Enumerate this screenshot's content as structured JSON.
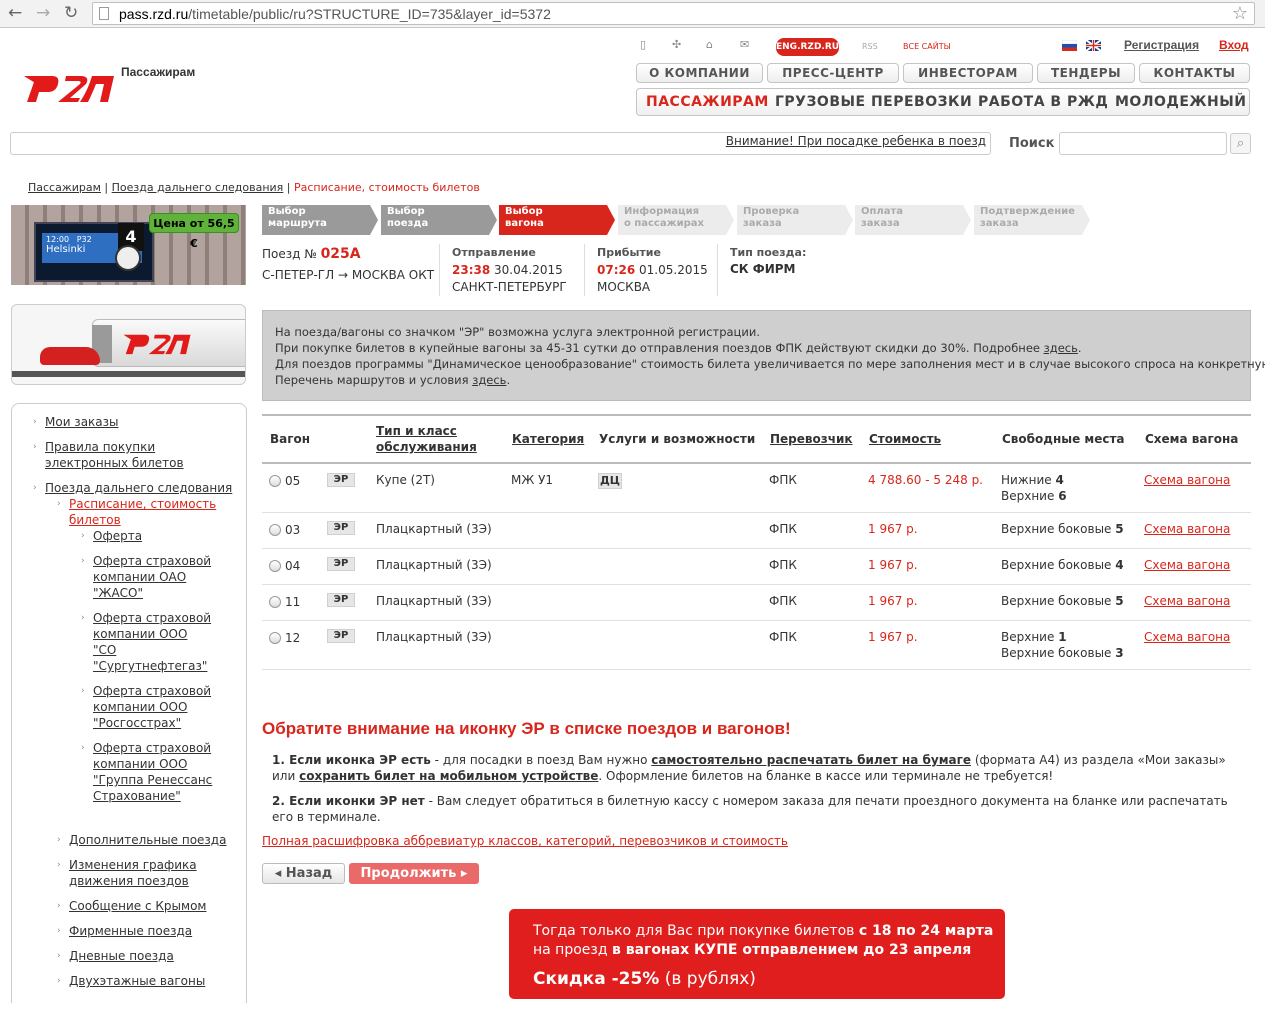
{
  "browser": {
    "url_host": "pass.rzd.ru",
    "url_path": "/timetable/public/ru?STRUCTURE_ID=735&layer_id=5372"
  },
  "header": {
    "logo_text": "Пассажирам",
    "eng": "ENG.RZD.RU",
    "rss": "RSS",
    "all_sites": "ВСЕ САЙТЫ",
    "register": "Регистрация",
    "login": "Вход",
    "top_nav": [
      "О КОМПАНИИ",
      "ПРЕСС-ЦЕНТР",
      "ИНВЕСТОРАМ",
      "ТЕНДЕРЫ",
      "КОНТАКТЫ"
    ],
    "main_nav": [
      "ПАССАЖИРАМ",
      "ГРУЗОВЫЕ ПЕРЕВОЗКИ",
      "РАБОТА В РЖД",
      "МОЛОДЕЖНЫЙ"
    ]
  },
  "search": {
    "alert_link": "Внимание! При посадке ребенка в поезд",
    "label": "Поиск"
  },
  "breadcrumb": {
    "items": [
      "Пассажирам",
      "Поезда дальнего следования"
    ],
    "current": "Расписание, стоимость билетов"
  },
  "banner": {
    "price": "Цена от 56,5 €",
    "board_time": "12:00",
    "board_city": "Helsinki",
    "board_code": "P32",
    "board_num": "4"
  },
  "left_menu": {
    "top": [
      "Мои заказы",
      "Правила покупки электронных билетов",
      "Поезда дальнего следования"
    ],
    "current": "Расписание, стоимость билетов",
    "sub": [
      "Оферта",
      "Оферта страховой компании ОАО \"ЖАСО\"",
      "Оферта страховой компании ООО \"СО \"Сургутнефтегаз\"",
      "Оферта страховой компании ООО \"Росгосстрах\"",
      "Оферта страховой компании ООО \"Группа Ренессанс Страхование\""
    ],
    "others": [
      "Дополнительные поезда",
      "Изменения графика движения поездов",
      "Сообщение с Крымом",
      "Фирменные поезда",
      "Дневные поезда",
      "Двухэтажные вагоны"
    ]
  },
  "steps": [
    {
      "l1": "Выбор",
      "l2": "маршрута"
    },
    {
      "l1": "Выбор",
      "l2": "поезда"
    },
    {
      "l1": "Выбор",
      "l2": "вагона"
    },
    {
      "l1": "Информация",
      "l2": "о пассажирах"
    },
    {
      "l1": "Проверка",
      "l2": "заказа"
    },
    {
      "l1": "Оплата",
      "l2": "заказа"
    },
    {
      "l1": "Подтверждение",
      "l2": "заказа"
    }
  ],
  "train": {
    "label": "Поезд №",
    "number": "025А",
    "route": "С-ПЕТЕР-ГЛ → МОСКВА ОКТ",
    "dep_label": "Отправление",
    "dep_time": "23:38",
    "dep_date": "30.04.2015",
    "dep_station": "САНКТ-ПЕТЕРБУРГ",
    "arr_label": "Прибытие",
    "arr_time": "07:26",
    "arr_date": "01.05.2015",
    "arr_station": "МОСКВА",
    "type_label": "Тип поезда:",
    "type": "СК ФИРМ"
  },
  "notice": {
    "l1": "На поезда/вагоны со значком \"ЭР\" возможна услуга электронной регистрации.",
    "l2": "При покупке билетов в купейные вагоны за 45-31 сутки до отправления поездов ФПК действуют скидки до 30%. Подробнее ",
    "l2link": "здесь",
    "l3": "Для поездов программы \"Динамическое ценообразование\" стоимость билета увеличивается по мере заполнения мест и в случае высокого спроса на конкретную дату.",
    "l4": "Перечень маршрутов и условия ",
    "l4link": "здесь"
  },
  "table": {
    "headers": {
      "car": "Вагон",
      "type1": "Тип и класс",
      "type2": "обслуживания",
      "category": "Категория",
      "services": "Услуги и возможности",
      "carrier": "Перевозчик",
      "cost": "Стоимость",
      "seats": "Свободные места",
      "scheme": "Схема вагона"
    },
    "rows": [
      {
        "car": "05",
        "er": "ЭР",
        "type": "Купе (2Т)",
        "category": "МЖ У1",
        "service": "ДЦ",
        "carrier": "ФПК",
        "cost": "4 788.60 - 5 248 р.",
        "seats1": "Нижние ",
        "n1": "4",
        "seats2": "Верхние ",
        "n2": "6",
        "scheme": "Схема вагона"
      },
      {
        "car": "03",
        "er": "ЭР",
        "type": "Плацкартный (3Э)",
        "carrier": "ФПК",
        "cost": "1 967 р.",
        "seats1": "Верхние боковые ",
        "n1": "5",
        "scheme": "Схема вагона"
      },
      {
        "car": "04",
        "er": "ЭР",
        "type": "Плацкартный (3Э)",
        "carrier": "ФПК",
        "cost": "1 967 р.",
        "seats1": "Верхние боковые ",
        "n1": "4",
        "scheme": "Схема вагона"
      },
      {
        "car": "11",
        "er": "ЭР",
        "type": "Плацкартный (3Э)",
        "carrier": "ФПК",
        "cost": "1 967 р.",
        "seats1": "Верхние боковые ",
        "n1": "5",
        "scheme": "Схема вагона"
      },
      {
        "car": "12",
        "er": "ЭР",
        "type": "Плацкартный (3Э)",
        "carrier": "ФПК",
        "cost": "1 967 р.",
        "seats1": "Верхние ",
        "n1": "1",
        "seats2": "Верхние боковые ",
        "n2": "3",
        "scheme": "Схема вагона"
      }
    ]
  },
  "attention": {
    "title": "Обратите внимание на иконку ЭР в списке поездов и вагонов!",
    "p1a": "1. Если иконка ЭР есть",
    "p1b": " - для посадки в поезд Вам нужно ",
    "p1c": "самостоятельно распечатать билет на бумаге",
    "p1d": " (формата А4) из раздела «Мои заказы» или ",
    "p1e": "сохранить билет на мобильном устройстве",
    "p1f": ". Оформление билетов на бланке в кассе или терминале не требуется!",
    "p2a": "2. Если иконки ЭР нет",
    "p2b": " - Вам следует обратиться в билетную кассу с номером заказа для печати проездного документа на бланке или распечатать его в терминале.",
    "full_link": "Полная расшифровка аббревиатур классов, категорий, перевозчиков и стоимость"
  },
  "buttons": {
    "back": "◂ Назад",
    "next": "Продолжить ▸"
  },
  "promo": {
    "l1a": "Тогда только для Вас при покупке билетов ",
    "l1b": "с 18 по 24 марта",
    "l2a": "на проезд ",
    "l2b": "в вагонах КУПЕ отправлением до 23 апреля",
    "l3a": "Скидка -25%",
    "l3b": " (в рублях)"
  },
  "colors": {
    "brand_red": "#d8261c",
    "step_done": "#9a9a9a",
    "notice_bg": "#cfcfcf",
    "promo_bg": "#e01e1e"
  }
}
